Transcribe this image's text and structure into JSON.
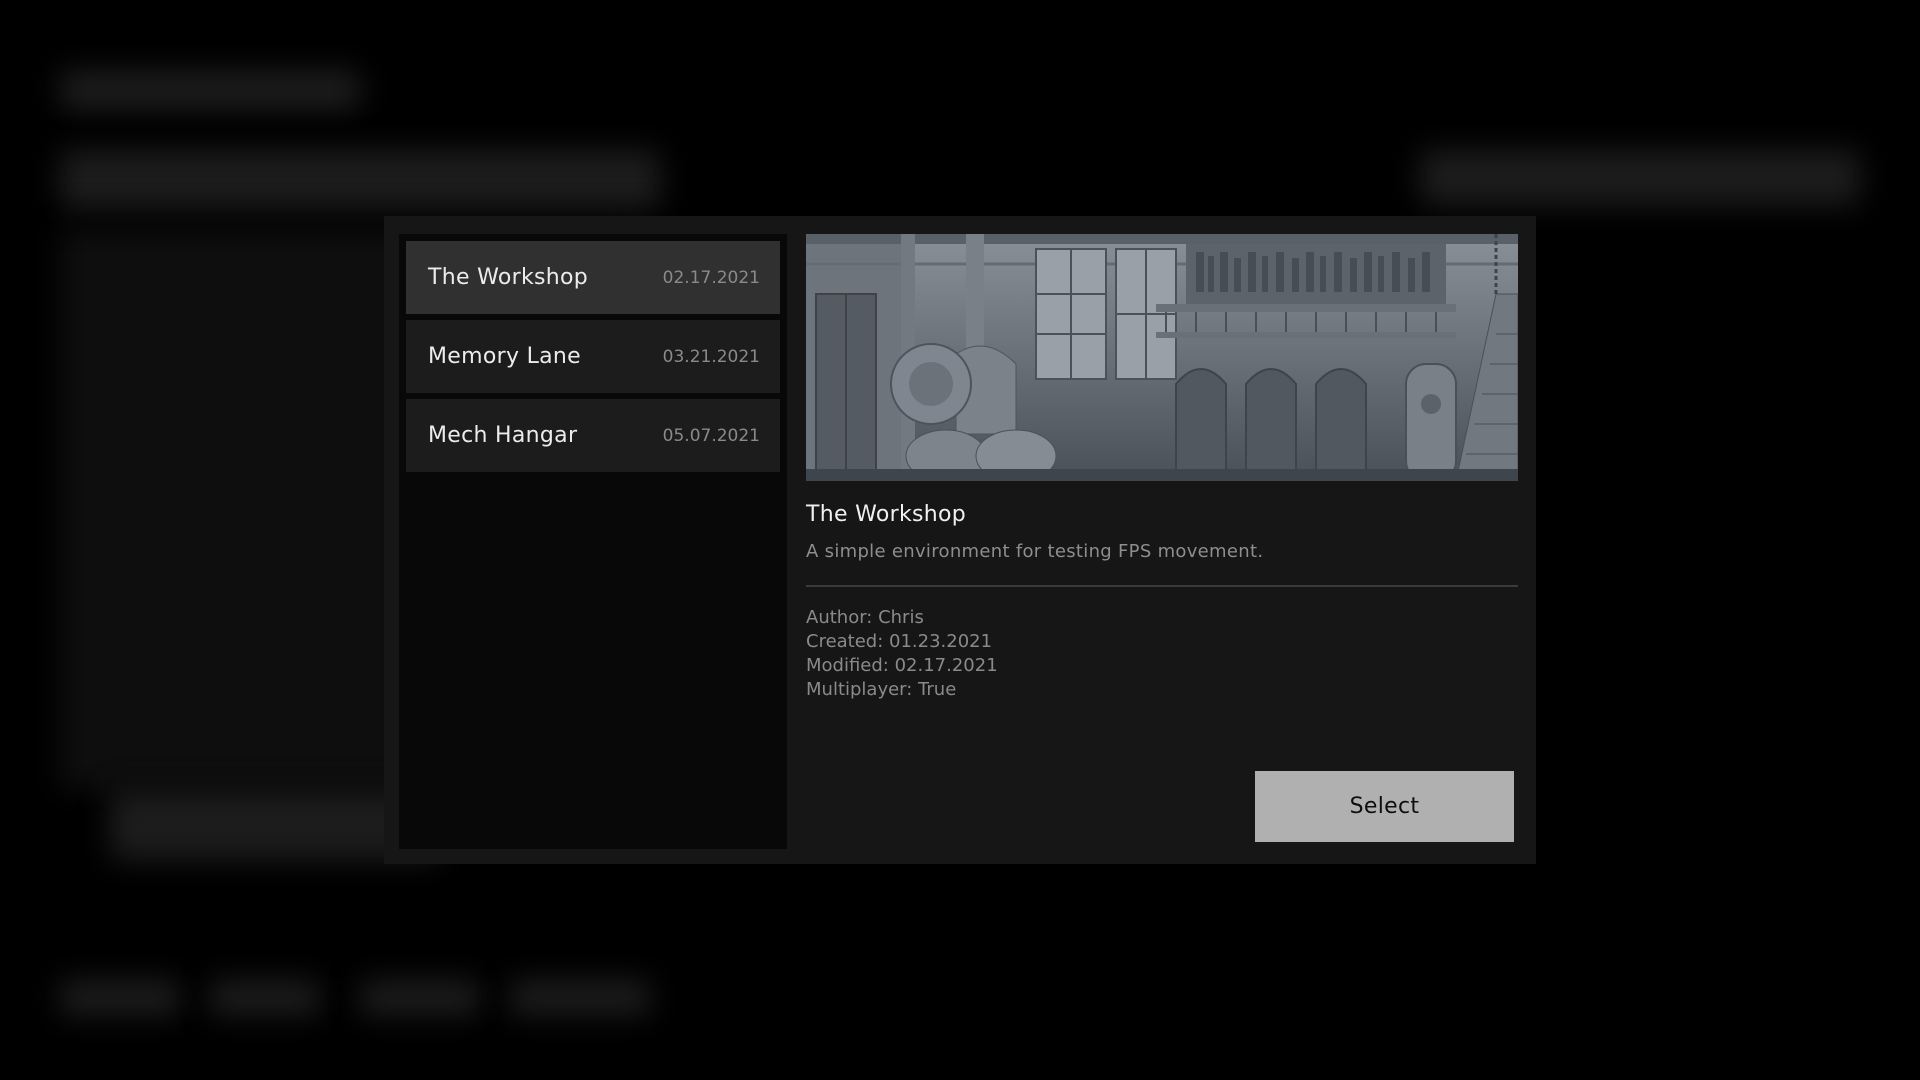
{
  "maps": [
    {
      "name": "The Workshop",
      "date": "02.17.2021",
      "selected": true
    },
    {
      "name": "Memory Lane",
      "date": "03.21.2021",
      "selected": false
    },
    {
      "name": "Mech Hangar",
      "date": "05.07.2021",
      "selected": false
    }
  ],
  "details": {
    "title": "The Workshop",
    "description": "A simple environment for testing FPS movement.",
    "author": "Author: Chris",
    "created": "Created: 01.23.2021",
    "modified": "Modified: 02.17.2021",
    "multiplayer": "Multiplayer: True"
  },
  "select_button": {
    "label": "Select"
  },
  "colors": {
    "modal_bg": "#161616",
    "list_bg": "#080808",
    "item_bg": "#1c1c1c",
    "item_selected_bg": "#303030",
    "button_bg": "#b0b0b0"
  }
}
